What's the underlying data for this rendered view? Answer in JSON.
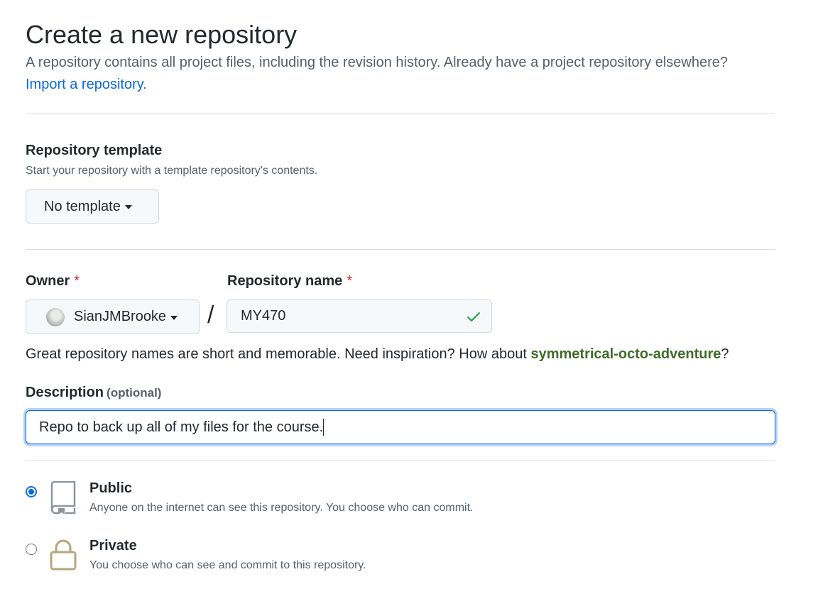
{
  "header": {
    "title": "Create a new repository",
    "subtitle": "A repository contains all project files, including the revision history. Already have a project repository elsewhere?",
    "import_link": "Import a repository."
  },
  "template": {
    "label": "Repository template",
    "help": "Start your repository with a template repository's contents.",
    "button": "No template"
  },
  "owner": {
    "label": "Owner",
    "required_mark": "*",
    "value": "SianJMBrooke"
  },
  "repo_name": {
    "label": "Repository name",
    "required_mark": "*",
    "value": "MY470",
    "separator": "/"
  },
  "hint": {
    "text": "Great repository names are short and memorable. Need inspiration? How about ",
    "suggestion": "symmetrical-octo-adventure",
    "suffix": "?"
  },
  "description": {
    "label": "Description",
    "optional": "(optional)",
    "value": "Repo to back up all of my files for the course."
  },
  "visibility": {
    "options": [
      {
        "title": "Public",
        "desc": "Anyone on the internet can see this repository. You choose who can commit.",
        "selected": true,
        "icon": "repo-icon"
      },
      {
        "title": "Private",
        "desc": "You choose who can see and commit to this repository.",
        "selected": false,
        "icon": "lock-icon"
      }
    ]
  },
  "colors": {
    "link": "#0969da",
    "required": "#cf222e",
    "success": "#2da44e",
    "suggestion": "#3f6b2b",
    "lock": "#b8a67a"
  }
}
